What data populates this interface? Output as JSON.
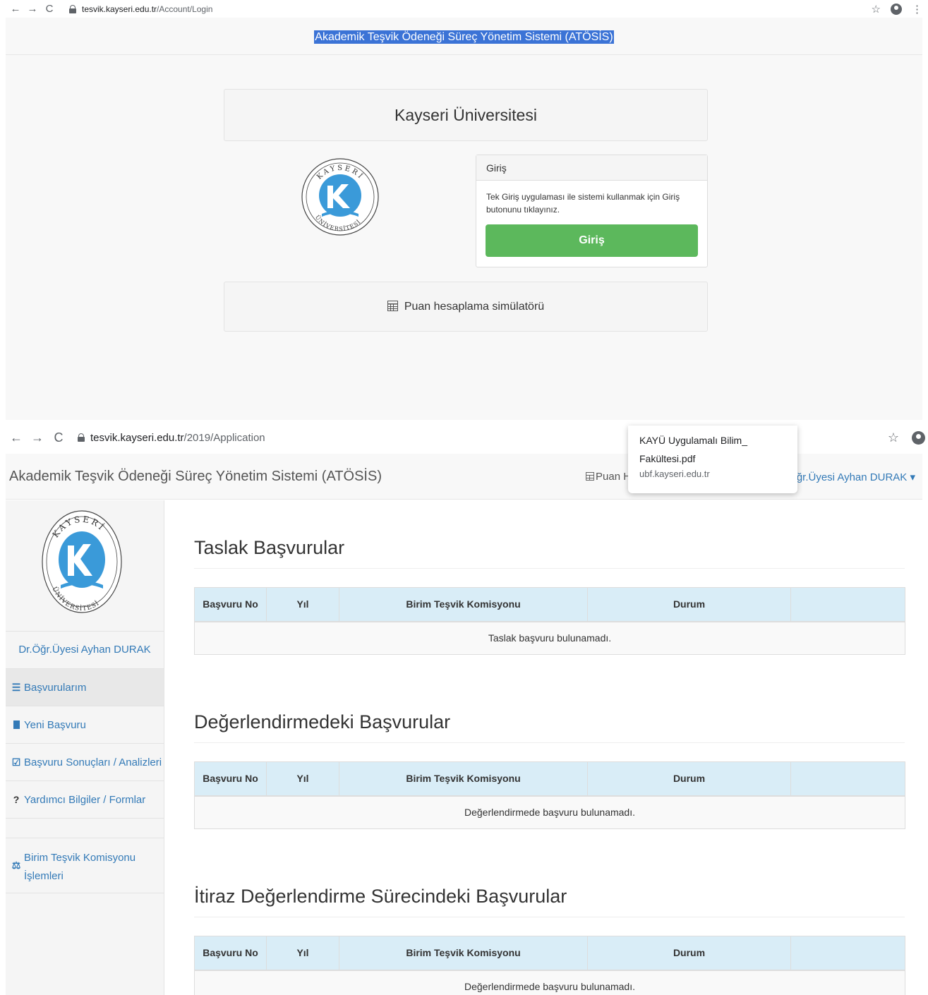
{
  "browser_top": {
    "url_host": "tesvik.kayseri.edu.tr",
    "url_path": "/Account/Login"
  },
  "login_page": {
    "header_title": "Akademik Teşvik Ödeneği Süreç Yönetim Sistemi (ATÖSİS)",
    "university_name": "Kayseri Üniversitesi",
    "login_panel": {
      "heading": "Giriş",
      "description": "Tek Giriş uygulaması ile sistemi kullanmak için Giriş butonunu tıklayınız.",
      "button_label": "Giriş",
      "button_color": "#5cb85c"
    },
    "simulator_label": "Puan hesaplama simülatörü"
  },
  "logo": {
    "top_text": "KAYSERİ",
    "bottom_text": "ÜNİVERSİTESİ",
    "letter": "K",
    "color": "#3a9ad9"
  },
  "browser_bottom": {
    "url_host": "tesvik.kayseri.edu.tr",
    "url_path": "/2019/Application"
  },
  "download_popup": {
    "title_line1": "KAYÜ Uygulamalı Bilim_",
    "title_line2": "Fakültesi.pdf",
    "domain": "ubf.kayseri.edu.tr"
  },
  "app_navbar": {
    "brand": "Akademik Teşvik Ödeneği Süreç Yönetim Sistemi (ATÖSİS)",
    "puan_label": "Puan H",
    "user_menu": "Dr.Öğr.Üyesi Ayhan DURAK",
    "user_caret": "▾"
  },
  "sidebar": {
    "user_name": "Dr.Öğr.Üyesi Ayhan DURAK",
    "items": [
      {
        "icon": "list-icon",
        "glyph": "☰",
        "label": "Başvurularım"
      },
      {
        "icon": "file-icon",
        "glyph": "▇",
        "label": "Yeni Başvuru"
      },
      {
        "icon": "check-square-icon",
        "glyph": "☑",
        "label": "Başvuru Sonuçları / Analizleri"
      },
      {
        "icon": "question-icon",
        "glyph": "?",
        "label": "Yardımcı Bilgiler / Formlar"
      }
    ],
    "commission": {
      "icon": "scale-icon",
      "glyph": "⚖",
      "label_line1": "Birim Teşvik Komisyonu",
      "label_line2": "İşlemleri"
    }
  },
  "table_headers": [
    "Başvuru No",
    "Yıl",
    "Birim Teşvik Komisyonu",
    "Durum",
    ""
  ],
  "sections": [
    {
      "title": "Taslak Başvurular",
      "empty_message": "Taslak başvuru bulunamadı."
    },
    {
      "title": "Değerlendirmedeki Başvurular",
      "empty_message": "Değerlendirmede başvuru bulunamadı."
    },
    {
      "title": "İtiraz Değerlendirme Sürecindeki Başvurular",
      "empty_message": "Değerlendirmede başvuru bulunamadı."
    }
  ]
}
